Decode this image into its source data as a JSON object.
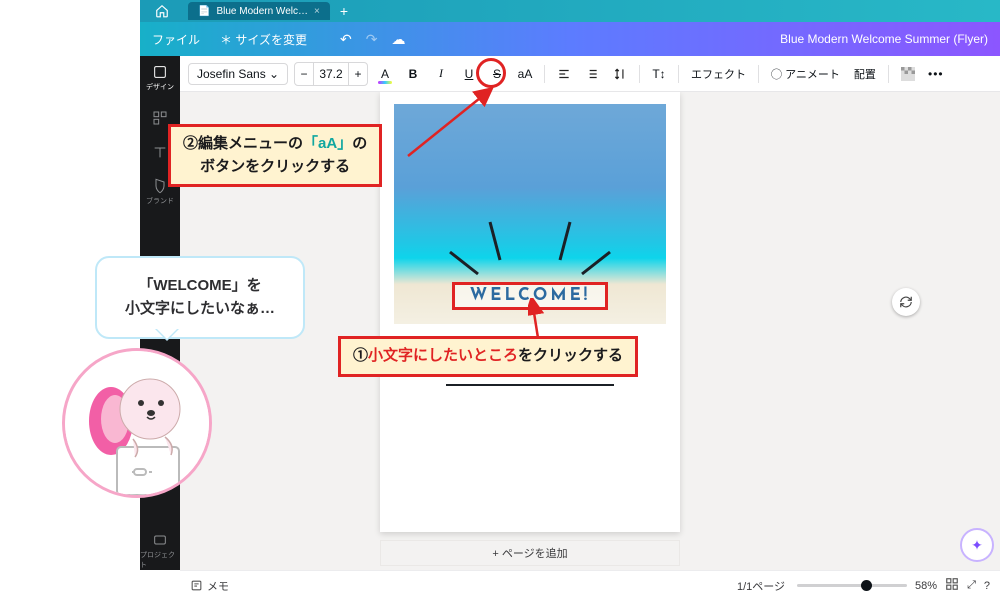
{
  "tabbar": {
    "tab_name": "Blue Modern Welc…"
  },
  "menubar": {
    "file": "ファイル",
    "resize": "＊ サイズを変更",
    "doc_title": "Blue Modern Welcome Summer (Flyer)"
  },
  "sidebar": {
    "design": "デザイン",
    "brand": "ブランド",
    "project": "プロジェクト"
  },
  "toolbar": {
    "font_name": "Josefin Sans",
    "font_size": "37.2",
    "minus": "−",
    "plus": "+",
    "A": "A",
    "B": "B",
    "I": "I",
    "U": "U",
    "S": "S",
    "aA": "aA",
    "T1": "T↕",
    "effect": "エフェクト",
    "animate": "アニメート",
    "position": "配置",
    "more": "•••"
  },
  "canvas": {
    "welcome_text": "WELCOME!",
    "add_page": "+ ページを追加"
  },
  "bottombar": {
    "memo": "メモ",
    "page_indicator": "1/1ページ",
    "zoom_pct": "58%"
  },
  "bubble": {
    "line1": "「WELCOME」を",
    "line2": "小文字にしたいなぁ…"
  },
  "annotations": {
    "box2_prefix": "②編集メニューの",
    "box2_teal": "「aA」",
    "box2_suffix": "の",
    "box2_line2": "ボタンをクリックする",
    "box1_prefix": "①",
    "box1_red": "小文字にしたいところ",
    "box1_suffix": "をクリックする"
  }
}
